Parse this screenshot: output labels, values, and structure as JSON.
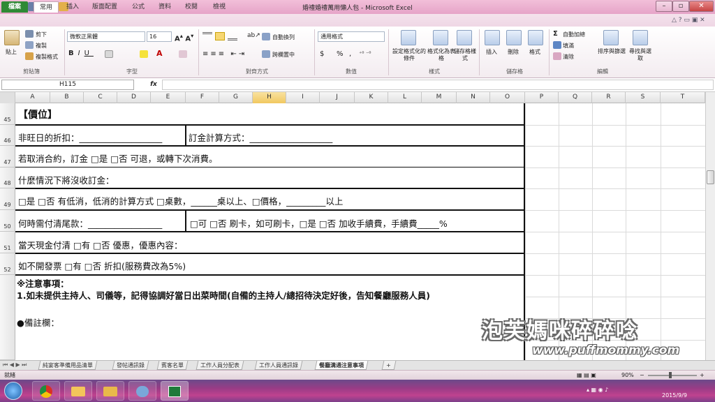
{
  "titlebar": {
    "title": "婚禮婚禮萬用懶人包 - Microsoft Excel"
  },
  "tabs": [
    "檔案",
    "常用",
    "插入",
    "版面配置",
    "公式",
    "資料",
    "校閱",
    "檢視"
  ],
  "ribbon": {
    "clipboard": {
      "paste": "貼上",
      "cut": "剪下",
      "copy": "複製",
      "format_painter": "複製格式",
      "label": "剪貼簿"
    },
    "font": {
      "name": "微軟正黑體",
      "size": "16",
      "label": "字型"
    },
    "alignment": {
      "wrap": "自動換列",
      "merge": "跨欄置中",
      "label": "對齊方式"
    },
    "number": {
      "format": "通用格式",
      "currency": "$",
      "percent": "%",
      "comma": ",",
      "label": "數值"
    },
    "styles": {
      "conditional": "設定格式化的條件",
      "table": "格式化為表格",
      "cell_styles": "儲存格樣式",
      "label": "樣式"
    },
    "cells": {
      "insert": "插入",
      "delete": "刪除",
      "format": "格式",
      "label": "儲存格"
    },
    "editing": {
      "autosum": "自動加總",
      "fill": "填滿",
      "clear": "清除",
      "sort": "排序與篩選",
      "find": "尋找與選取",
      "label": "編輯"
    }
  },
  "formula_bar": {
    "name_box": "H115",
    "fx": "fx",
    "formula": ""
  },
  "columns": [
    "A",
    "B",
    "C",
    "D",
    "E",
    "F",
    "G",
    "H",
    "I",
    "J",
    "K",
    "L",
    "M",
    "N",
    "O",
    "P",
    "Q",
    "R",
    "S",
    "T"
  ],
  "rows": [
    "45",
    "46",
    "47",
    "48",
    "49",
    "50",
    "51",
    "52"
  ],
  "sheet": {
    "heading": "【價位】",
    "r46a": "非旺日的折扣：___________________",
    "r46b": "訂金計算方式：___________________",
    "r47": "若取消合約，訂金 □是 □否 可退，或轉下次消費。",
    "r48": "什麼情況下將沒收訂金：",
    "r49": "□是 □否 有低消，低消的計算方式 □桌數，______桌以上、□價格，_________以上",
    "r50a": "何時需付清尾款：_________________",
    "r50b": "□可 □否 刷卡，如可刷卡，□是 □否 加收手續費，手續費_____%",
    "r51": "當天現金付清 □有 □否 優惠，優惠內容：",
    "r52": "如不開發票 □有 □否 折扣(服務費改為5%)",
    "notes_title": "※注意事項：",
    "notes_1": "1.如未提供主持人、司儀等，記得協調好當日出菜時間(自備的主持人/總招待決定好後，告知餐廳服務人員)",
    "remark": "●備註欄："
  },
  "sheet_tabs": [
    "純宴客準備用品清單",
    "發帖通訊錄",
    "賓客名單",
    "工作人員分配表",
    "工作人員通訊錄",
    "餐廳溝通注意事項"
  ],
  "status": {
    "ready": "就緒",
    "zoom": "90%"
  },
  "taskbar": {
    "date": "2015/9/9"
  },
  "watermark": {
    "text": "泡芙媽咪碎碎唸",
    "url": "www.puffmommy.com"
  },
  "colors": {
    "file_tab": "#2f8a35",
    "titlebar": "#eab0cf",
    "taskbar": "#9a3c86"
  }
}
